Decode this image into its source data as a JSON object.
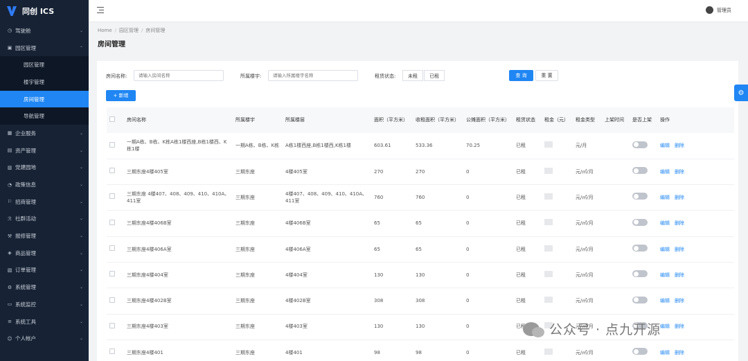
{
  "app": {
    "title": "同创 ICS"
  },
  "sidebar": {
    "items": [
      {
        "label": "驾驶舱",
        "icon": "dashboard-icon",
        "glyph": "◷"
      },
      {
        "label": "园区管理",
        "icon": "park-icon",
        "glyph": "▣",
        "expanded": true,
        "children": [
          {
            "label": "园区管理",
            "active": false
          },
          {
            "label": "楼宇管理",
            "active": false
          },
          {
            "label": "房间管理",
            "active": true
          },
          {
            "label": "导航管理",
            "active": false
          }
        ]
      },
      {
        "label": "企业服务",
        "icon": "enterprise-icon",
        "glyph": "▦"
      },
      {
        "label": "资产管理",
        "icon": "asset-icon",
        "glyph": "▤"
      },
      {
        "label": "党建园地",
        "icon": "party-icon",
        "glyph": "▥"
      },
      {
        "label": "政策信息",
        "icon": "policy-icon",
        "glyph": "◔"
      },
      {
        "label": "招商管理",
        "icon": "investment-icon",
        "glyph": "⚐"
      },
      {
        "label": "社群活动",
        "icon": "community-icon",
        "glyph": "ℛ"
      },
      {
        "label": "报修管理",
        "icon": "repair-icon",
        "glyph": "⚒"
      },
      {
        "label": "商品管理",
        "icon": "goods-icon",
        "glyph": "◈"
      },
      {
        "label": "订单管理",
        "icon": "order-icon",
        "glyph": "▧"
      },
      {
        "label": "系统管理",
        "icon": "system-icon",
        "glyph": "⚙"
      },
      {
        "label": "系统监控",
        "icon": "monitor-icon",
        "glyph": "▭"
      },
      {
        "label": "系统工具",
        "icon": "tools-icon",
        "glyph": "≡"
      },
      {
        "label": "个人帐户",
        "icon": "account-icon",
        "glyph": "☺"
      }
    ]
  },
  "topbar": {
    "user_name": "管理员"
  },
  "breadcrumb": {
    "home": "Home",
    "level1": "园区管理",
    "current": "房间管理"
  },
  "page_title": "房间管理",
  "filters": {
    "room_name_label": "房间名称:",
    "room_name_placeholder": "请输入房间名称",
    "building_label": "所属楼宇:",
    "building_placeholder": "请输入所属楼宇名称",
    "rent_status_label": "租赁状态:",
    "status_options": [
      "未租",
      "已租"
    ],
    "search_label": "查 询",
    "reset_label": "重 置"
  },
  "toolbar": {
    "add_label": "+ 新增"
  },
  "table": {
    "columns": [
      "房间名称",
      "所属楼宇",
      "所属楼层",
      "面积（平方米）",
      "收租面积（平方米）",
      "公摊面积（平方米）",
      "租赁状态",
      "租金（元）",
      "租金类型",
      "上架时间",
      "是否上架",
      "操作"
    ],
    "edit_label": "编辑",
    "delete_label": "删除",
    "rows": [
      {
        "name": "一期A栋、B栋、K栋A栋1楼西座,B栋1楼西、K栋1楼",
        "building": "一期A栋、B栋、K栋",
        "floor": "A栋1楼西座,B栋1楼西,K栋1楼",
        "area": "603.61",
        "rent_area": "533.36",
        "shared_area": "70.25",
        "status": "已租",
        "rent_type": "元/月"
      },
      {
        "name": "三期东座4楼405室",
        "building": "三期东座",
        "floor": "4楼405室",
        "area": "270",
        "rent_area": "270",
        "shared_area": "0",
        "status": "已租",
        "rent_type": "元/㎡/月"
      },
      {
        "name": "三期东座 4楼407、408、409、410、410A、411室",
        "building": "三期东座",
        "floor": "4楼407、408、409、410、410A、411室",
        "area": "760",
        "rent_area": "760",
        "shared_area": "0",
        "status": "已租",
        "rent_type": "元/㎡/月"
      },
      {
        "name": "三期东座4楼406B室",
        "building": "三期东座",
        "floor": "4楼406B室",
        "area": "65",
        "rent_area": "65",
        "shared_area": "0",
        "status": "已租",
        "rent_type": "元/㎡/月"
      },
      {
        "name": "三期东座4楼406A室",
        "building": "三期东座",
        "floor": "4楼406A室",
        "area": "65",
        "rent_area": "65",
        "shared_area": "0",
        "status": "已租",
        "rent_type": "元/㎡/月"
      },
      {
        "name": "三期东座4楼404室",
        "building": "三期东座",
        "floor": "4楼404室",
        "area": "130",
        "rent_area": "130",
        "shared_area": "0",
        "status": "已租",
        "rent_type": "元/㎡/月"
      },
      {
        "name": "三期东座4楼402B室",
        "building": "三期东座",
        "floor": "4楼402B室",
        "area": "308",
        "rent_area": "308",
        "shared_area": "0",
        "status": "已租",
        "rent_type": "元/㎡/月"
      },
      {
        "name": "三期东座4楼403室",
        "building": "三期东座",
        "floor": "4楼403室",
        "area": "130",
        "rent_area": "130",
        "shared_area": "0",
        "status": "已租",
        "rent_type": "元/㎡/月"
      },
      {
        "name": "三期东座4楼401",
        "building": "三期东座",
        "floor": "4楼401",
        "area": "98",
        "rent_area": "98",
        "shared_area": "0",
        "status": "已租",
        "rent_type": "元/㎡/月"
      }
    ]
  },
  "watermark": {
    "text": "公众号 · 点九开源"
  }
}
